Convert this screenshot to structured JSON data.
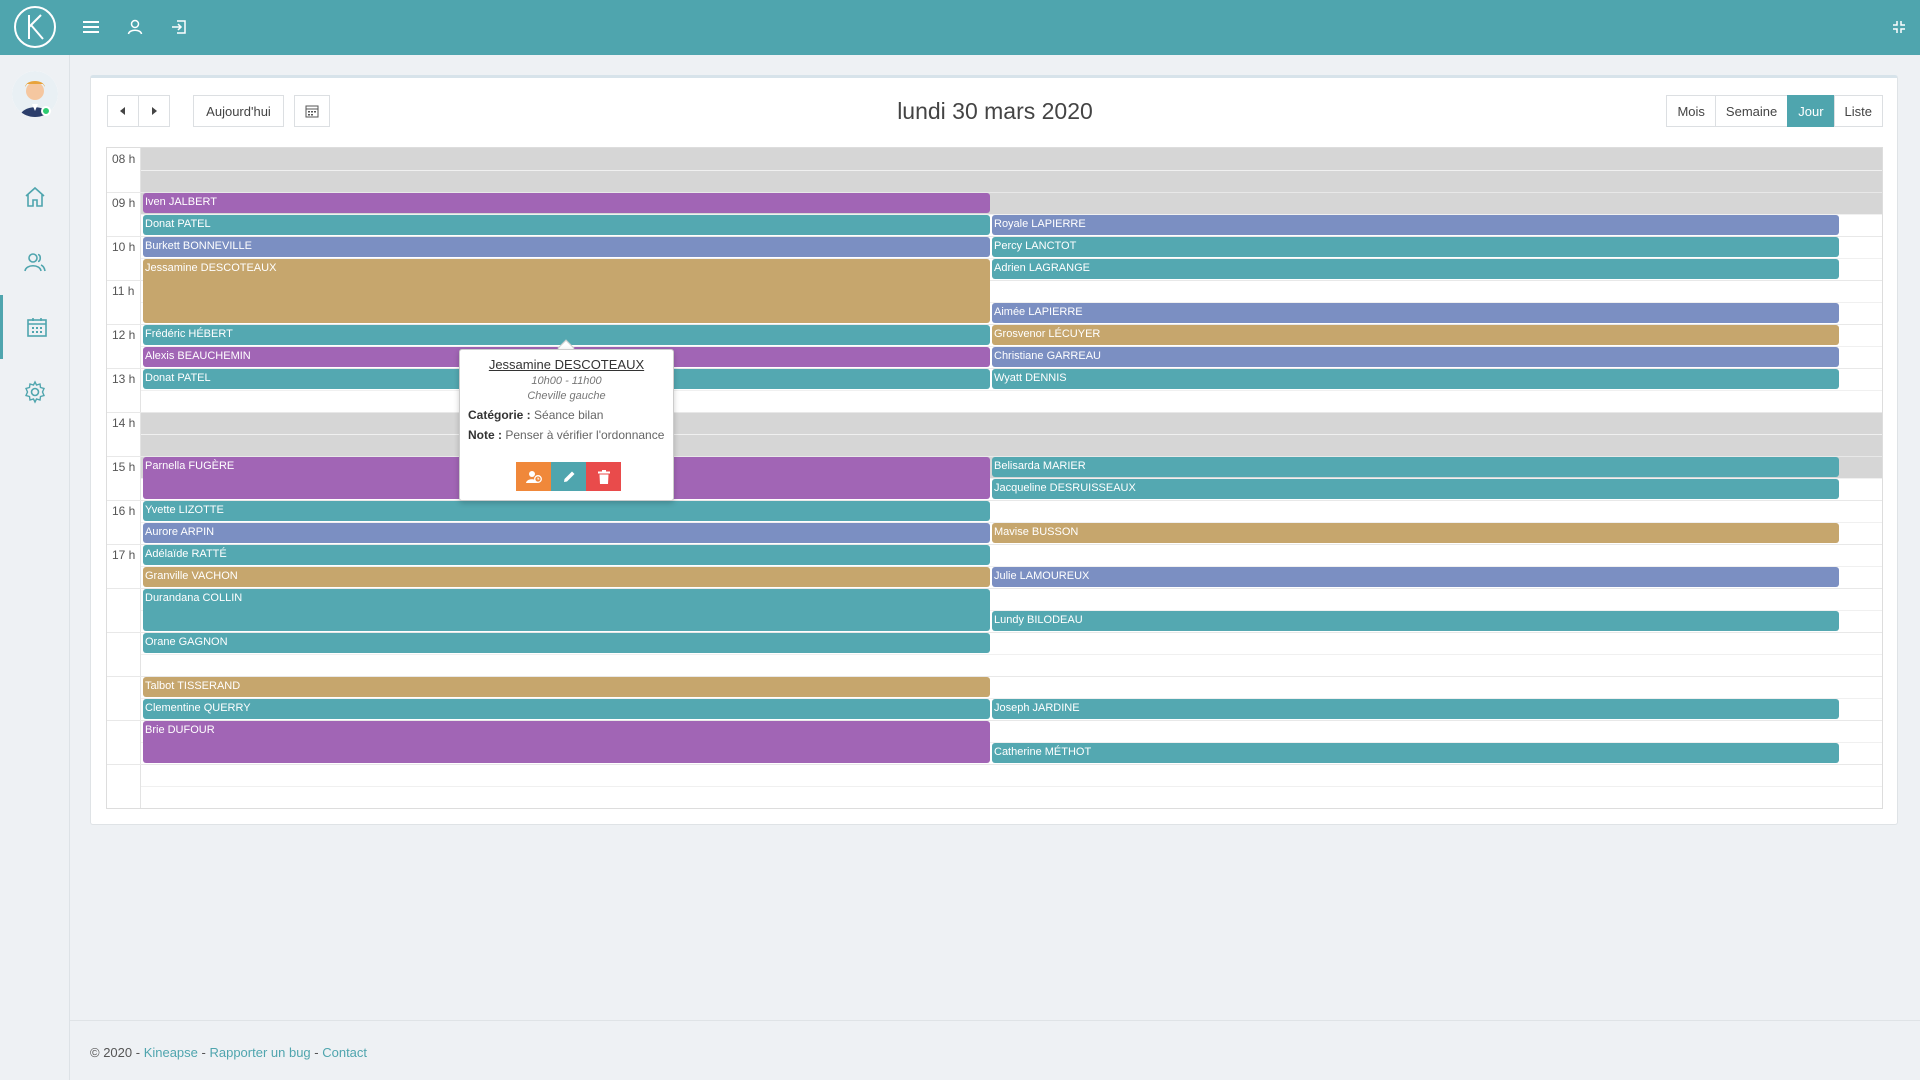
{
  "app": {
    "logo_letter": "K"
  },
  "toolbar": {
    "today_label": "Aujourd'hui",
    "title": "lundi 30 mars 2020",
    "views": [
      "Mois",
      "Semaine",
      "Jour",
      "Liste"
    ],
    "active_view": "Jour"
  },
  "hours": [
    "08 h",
    "09 h",
    "10 h",
    "11 h",
    "12 h",
    "13 h",
    "14 h",
    "15 h",
    "16 h",
    "17 h"
  ],
  "colors": {
    "accent": "#4fa5ae",
    "teal": "#54a8b1",
    "purple": "#a165b5",
    "blue": "#7b8fc2",
    "tan": "#c6a66d"
  },
  "events_left": [
    {
      "name": "Iven JALBERT",
      "start": "09:00",
      "end": "09:30",
      "color": "purple"
    },
    {
      "name": "Donat PATEL",
      "start": "09:30",
      "end": "10:00",
      "color": "teal"
    },
    {
      "name": "Burkett BONNEVILLE",
      "start": "10:00",
      "end": "10:30",
      "color": "blue"
    },
    {
      "name": "Jessamine DESCOTEAUX",
      "start": "10:30",
      "end": "12:00",
      "color": "tan"
    },
    {
      "name": "Frédéric HÉBERT",
      "start": "12:00",
      "end": "12:30",
      "color": "teal"
    },
    {
      "name": "Alexis BEAUCHEMIN",
      "start": "12:30",
      "end": "13:00",
      "color": "purple"
    },
    {
      "name": "Donat PATEL",
      "start": "13:00",
      "end": "13:30",
      "color": "teal"
    },
    {
      "name": "Parnella FUGÈRE",
      "start": "15:00",
      "end": "16:00",
      "color": "purple"
    },
    {
      "name": "Yvette LIZOTTE",
      "start": "16:00",
      "end": "16:30",
      "color": "teal"
    },
    {
      "name": "Aurore ARPIN",
      "start": "16:30",
      "end": "17:00",
      "color": "blue"
    },
    {
      "name": "Adélaïde RATTÉ",
      "start": "17:00",
      "end": "17:30",
      "color": "teal"
    },
    {
      "name": "Granville VACHON",
      "start": "17:30",
      "end": "18:00",
      "color": "tan"
    },
    {
      "name": "Durandana COLLIN",
      "start": "18:00",
      "end": "19:00",
      "color": "teal"
    },
    {
      "name": "Orane GAGNON",
      "start": "19:00",
      "end": "19:30",
      "color": "teal"
    },
    {
      "name": "Talbot TISSERAND",
      "start": "20:00",
      "end": "20:30",
      "color": "tan"
    },
    {
      "name": "Clementine QUERRY",
      "start": "20:30",
      "end": "21:00",
      "color": "teal"
    },
    {
      "name": "Brie DUFOUR",
      "start": "21:00",
      "end": "22:00",
      "color": "purple"
    }
  ],
  "events_right": [
    {
      "name": "Royale LAPIERRE",
      "start": "09:30",
      "end": "10:00",
      "color": "blue"
    },
    {
      "name": "Percy LANCTOT",
      "start": "10:00",
      "end": "10:30",
      "color": "teal"
    },
    {
      "name": "Adrien LAGRANGE",
      "start": "10:30",
      "end": "11:00",
      "color": "teal"
    },
    {
      "name": "Aimée LAPIERRE",
      "start": "11:30",
      "end": "12:00",
      "color": "blue"
    },
    {
      "name": "Grosvenor LÉCUYER",
      "start": "12:00",
      "end": "12:30",
      "color": "tan"
    },
    {
      "name": "Christiane GARREAU",
      "start": "12:30",
      "end": "13:00",
      "color": "blue"
    },
    {
      "name": "Wyatt DENNIS",
      "start": "13:00",
      "end": "13:30",
      "color": "teal"
    },
    {
      "name": "Belisarda MARIER",
      "start": "15:00",
      "end": "15:30",
      "color": "teal"
    },
    {
      "name": "Jacqueline DESRUISSEAUX",
      "start": "15:30",
      "end": "16:00",
      "color": "teal"
    },
    {
      "name": "Mavise BUSSON",
      "start": "16:30",
      "end": "17:00",
      "color": "tan"
    },
    {
      "name": "Julie LAMOUREUX",
      "start": "17:30",
      "end": "18:00",
      "color": "blue"
    },
    {
      "name": "Lundy BILODEAU",
      "start": "18:30",
      "end": "19:00",
      "color": "teal"
    },
    {
      "name": "Joseph JARDINE",
      "start": "20:30",
      "end": "21:00",
      "color": "teal"
    },
    {
      "name": "Catherine MÉTHOT",
      "start": "21:30",
      "end": "22:00",
      "color": "teal"
    }
  ],
  "popover": {
    "name": "Jessamine DESCOTEAUX",
    "time": "10h00 - 11h00",
    "location": "Cheville gauche",
    "category_label": "Catégorie :",
    "category": "Séance bilan",
    "note_label": "Note :",
    "note": "Penser à vérifier l'ordonnance"
  },
  "footer": {
    "copyright": "© 2020 -",
    "sep": " - ",
    "brand": "Kineapse",
    "bug": "Rapporter un bug",
    "contact": "Contact"
  }
}
